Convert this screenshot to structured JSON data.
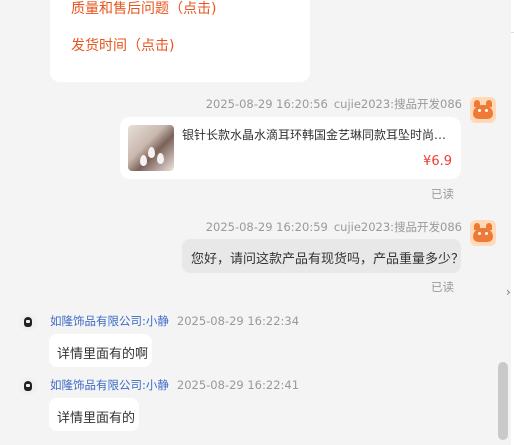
{
  "quick_replies": [
    {
      "label": "质量和售后问题（点击)"
    },
    {
      "label": "发货时间（点击)"
    }
  ],
  "messages": [
    {
      "time": "2025-08-29 16:20:56",
      "sender": "cujie2023:搜品开发086",
      "product": {
        "title": "银针长款水晶水滴耳环韩国金艺琳同款耳坠时尚气质高...",
        "price": "¥6.9"
      },
      "status": "已读"
    },
    {
      "time": "2025-08-29 16:20:59",
      "sender": "cujie2023:搜品开发086",
      "text": "您好，请问这款产品有现货吗，产品重量多少？",
      "status": "已读"
    },
    {
      "sender": "如隆饰品有限公司:小静",
      "time": "2025-08-29 16:22:34",
      "text": "详情里面有的啊"
    },
    {
      "sender": "如隆饰品有限公司:小静",
      "time": "2025-08-29 16:22:41",
      "text": "详情里面有的"
    }
  ],
  "icons": {
    "self_avatar": "cartoon-cat-avatar",
    "seller_avatar": "seller-logo-avatar",
    "expand": "chevron-right-icon"
  },
  "colors": {
    "link": "#e8541d",
    "price": "#f23b2f",
    "seller_name": "#3d6ac6",
    "background": "#f4f4f4"
  }
}
